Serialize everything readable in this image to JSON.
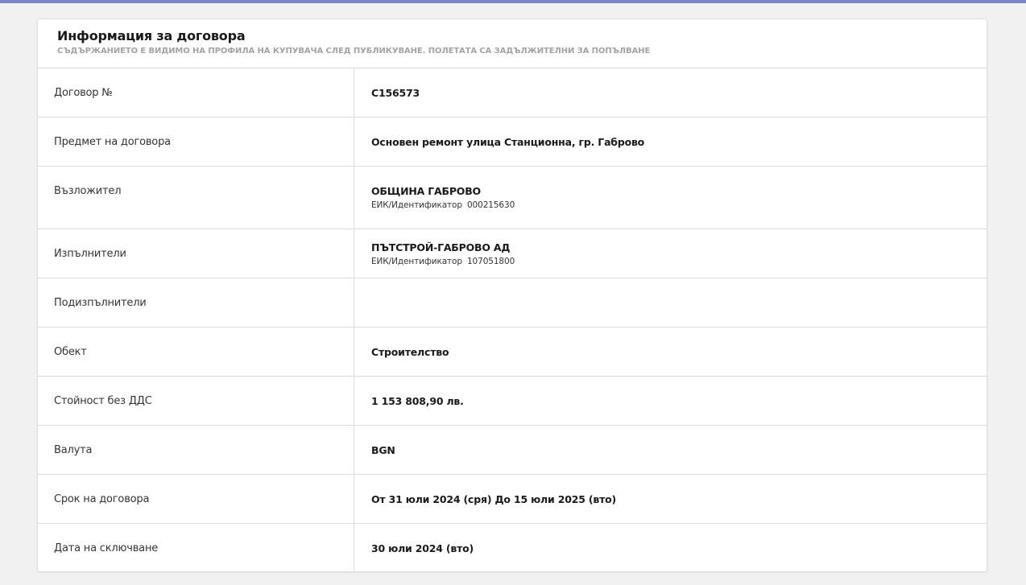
{
  "card": {
    "title": "Информация за договора",
    "subtitle": "СЪДЪРЖАНИЕТО Е ВИДИМО НА ПРОФИЛА НА КУПУВАЧА СЛЕД ПУБЛИКУВАНЕ. ПОЛЕТАТА СА ЗАДЪЛЖИТЕЛНИ ЗА ПОПЪЛВАНЕ"
  },
  "rows": {
    "contract_no": {
      "label": "Договор №",
      "value": "C156573"
    },
    "subject": {
      "label": "Предмет на договора",
      "value": "Основен ремонт улица Станционна, гр. Габрово"
    },
    "assignor": {
      "label": "Възложител",
      "value": "ОБЩИНА ГАБРОВО",
      "id_label": "ЕИК/Идентификатор",
      "id_value": "000215630"
    },
    "contractors": {
      "label": "Изпълнители",
      "value": "ПЪТСТРОЙ-ГАБРОВО АД",
      "id_label": "ЕИК/Идентификатор",
      "id_value": "107051800"
    },
    "subcontractors": {
      "label": "Подизпълнители",
      "value": ""
    },
    "object": {
      "label": "Обект",
      "value": "Строителство"
    },
    "value_without_vat": {
      "label": "Стойност без ДДС",
      "value": "1 153 808,90 лв."
    },
    "currency": {
      "label": "Валута",
      "value": "BGN"
    },
    "term": {
      "label": "Срок на договора",
      "value": "От 31 юли 2024 (сря) До 15 юли 2025 (вто)"
    },
    "signing_date": {
      "label": "Дата на сключване",
      "value": "30 юли 2024 (вто)"
    }
  },
  "colors": {
    "accent": "#7a86c6",
    "background": "#f1f1f2",
    "border": "#dcdcdc",
    "subtitle": "#a3a3a3"
  }
}
